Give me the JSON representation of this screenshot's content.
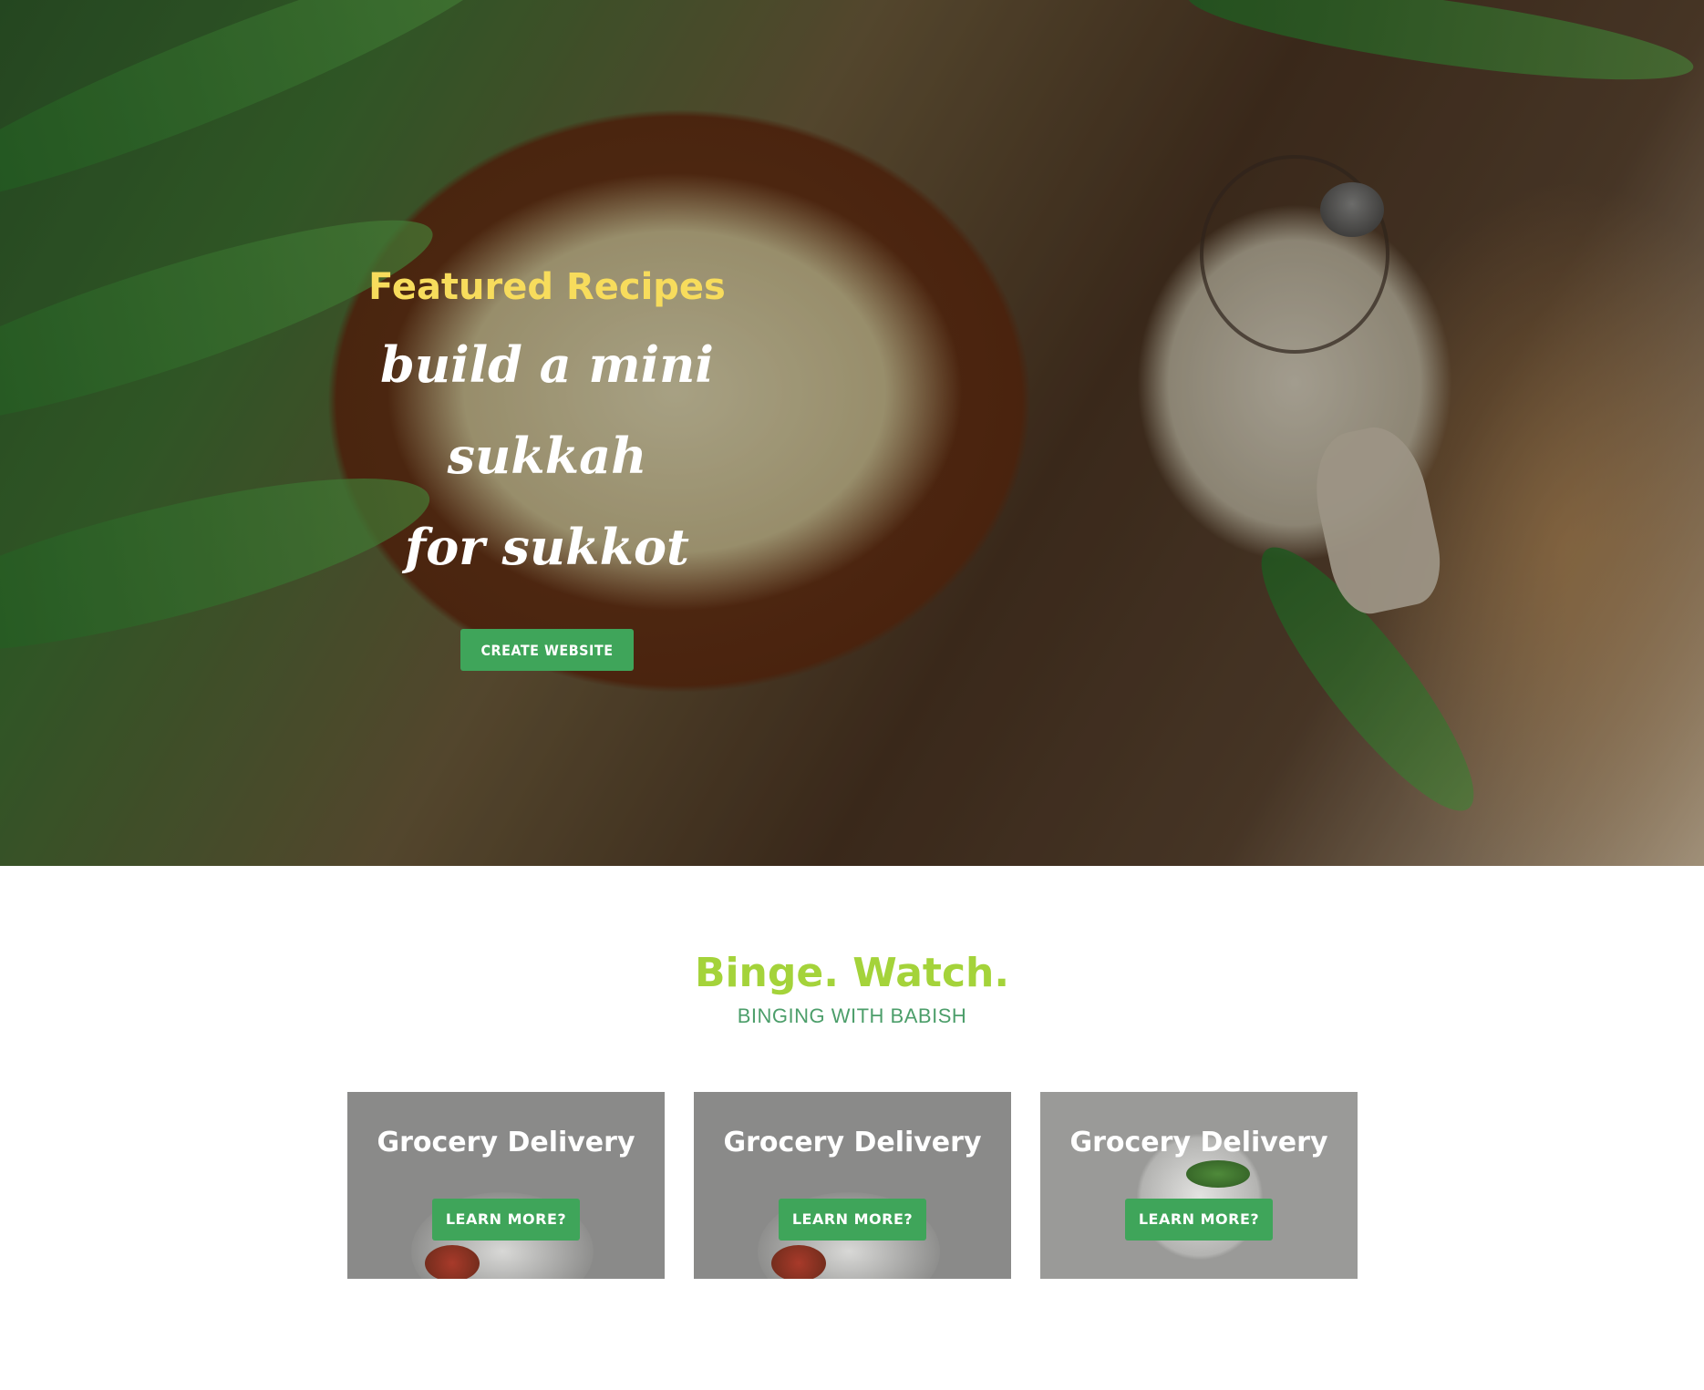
{
  "hero": {
    "eyebrow": "Featured Recipes",
    "title_line1": "build a mini sukkah",
    "title_line2": "for sukkot",
    "button_label": "CREATE WEBSITE"
  },
  "section": {
    "title": "Binge. Watch.",
    "subtitle": "BINGING WITH BABISH"
  },
  "cards": [
    {
      "title": "Grocery Delivery",
      "button_label": "LEARN MORE?"
    },
    {
      "title": "Grocery Delivery",
      "button_label": "LEARN MORE?"
    },
    {
      "title": "Grocery Delivery",
      "button_label": "LEARN MORE?"
    }
  ],
  "colors": {
    "accent_green": "#3fa55a",
    "eyebrow_yellow": "#f7dc5c",
    "heading_lime": "#a4d33a",
    "subheading_green": "#4c9e6a"
  }
}
